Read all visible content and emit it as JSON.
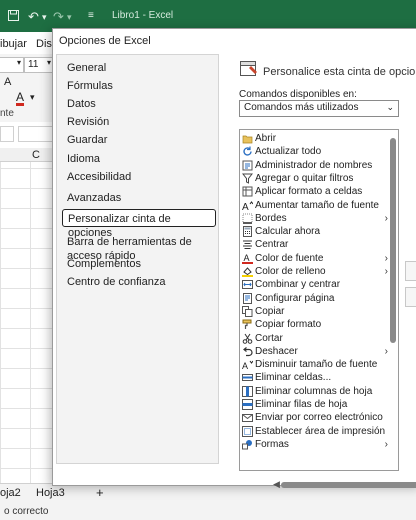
{
  "excel": {
    "title": "Libro1 - Excel",
    "qa_icons": [
      "save-icon",
      "undo-icon",
      "redo-icon",
      "customize-icon"
    ],
    "tabs": [
      "ibujar",
      "Disp"
    ],
    "font_size": "11",
    "col_c": "C",
    "sheets": [
      "oja2",
      "Hoja3"
    ],
    "add_sheet": "+",
    "status": "o correcto"
  },
  "dialog": {
    "title": "Opciones de Excel",
    "nav": [
      "General",
      "Fórmulas",
      "Datos",
      "Revisión",
      "Guardar",
      "Idioma",
      "Accesibilidad",
      "Avanzadas",
      "Personalizar cinta de opciones",
      "Barra de herramientas de acceso rápido",
      "Complementos",
      "Centro de confianza"
    ],
    "selected_index": 8,
    "header": "Personalice esta cinta de opciones.",
    "commands_label": "Comandos disponibles en:",
    "commands_value": "Comandos más utilizados",
    "commands": [
      {
        "label": "Abrir",
        "icon": "folder-icon",
        "sub": false
      },
      {
        "label": "Actualizar todo",
        "icon": "refresh-icon",
        "sub": false
      },
      {
        "label": "Administrador de nombres",
        "icon": "name-manager-icon",
        "sub": false
      },
      {
        "label": "Agregar o quitar filtros",
        "icon": "filter-icon",
        "sub": false
      },
      {
        "label": "Aplicar formato a celdas",
        "icon": "format-cells-icon",
        "sub": false
      },
      {
        "label": "Aumentar tamaño de fuente",
        "icon": "font-grow-icon",
        "sub": false
      },
      {
        "label": "Bordes",
        "icon": "borders-icon",
        "sub": true
      },
      {
        "label": "Calcular ahora",
        "icon": "calculator-icon",
        "sub": false
      },
      {
        "label": "Centrar",
        "icon": "align-center-icon",
        "sub": false
      },
      {
        "label": "Color de fuente",
        "icon": "font-color-icon",
        "sub": true
      },
      {
        "label": "Color de relleno",
        "icon": "fill-color-icon",
        "sub": true
      },
      {
        "label": "Combinar y centrar",
        "icon": "merge-icon",
        "sub": false
      },
      {
        "label": "Configurar página",
        "icon": "page-setup-icon",
        "sub": false
      },
      {
        "label": "Copiar",
        "icon": "copy-icon",
        "sub": false
      },
      {
        "label": "Copiar formato",
        "icon": "format-painter-icon",
        "sub": false
      },
      {
        "label": "Cortar",
        "icon": "scissors-icon",
        "sub": false
      },
      {
        "label": "Deshacer",
        "icon": "undo-icon",
        "sub": true
      },
      {
        "label": "Disminuir tamaño de fuente",
        "icon": "font-shrink-icon",
        "sub": false
      },
      {
        "label": "Eliminar celdas...",
        "icon": "delete-cells-icon",
        "sub": false
      },
      {
        "label": "Eliminar columnas de hoja",
        "icon": "delete-columns-icon",
        "sub": false
      },
      {
        "label": "Eliminar filas de hoja",
        "icon": "delete-rows-icon",
        "sub": false
      },
      {
        "label": "Enviar por correo electrónico",
        "icon": "email-icon",
        "sub": false
      },
      {
        "label": "Establecer área de impresión",
        "icon": "print-area-icon",
        "sub": false
      },
      {
        "label": "Formas",
        "icon": "shapes-icon",
        "sub": true
      }
    ]
  },
  "colors": {
    "excel_green": "#1e6e42",
    "font_red": "#d0281e",
    "fill_yellow": "#f5d000",
    "icon_blue": "#2b6fc2"
  }
}
